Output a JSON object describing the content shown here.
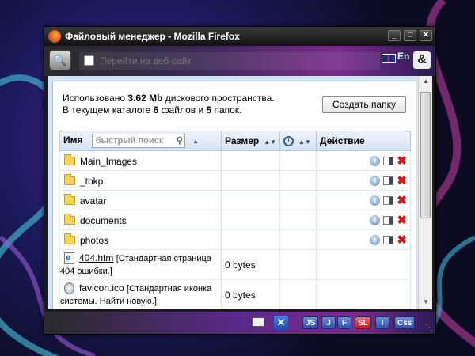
{
  "window": {
    "title": "Файловый менеджер - Mozilla Firefox",
    "controls": {
      "minimize": "_",
      "maximize": "□",
      "close": "✕"
    }
  },
  "toolbar": {
    "search_placeholder": "Перейти на веб-сайт",
    "lang": "En",
    "amp": "&"
  },
  "info": {
    "used_prefix": "Использовано ",
    "used_value": "3.62 Mb",
    "used_suffix": " дискового пространства.",
    "dir_prefix": "В текущем каталоге ",
    "files_count": "6",
    "files_mid": " файлов и ",
    "folders_count": "5",
    "folders_suffix": " папок."
  },
  "create_folder_label": "Создать папку",
  "table": {
    "headers": {
      "name": "Имя",
      "size": "Размер",
      "action": "Действие"
    },
    "search_placeholder": "быстрый поиск",
    "folders": [
      "Main_Images",
      "_tbkp",
      "avatar",
      "documents",
      "photos"
    ],
    "files": [
      {
        "name": "404.htm",
        "desc": "[Стандартная страница 404 ошибки.]",
        "size": "0 bytes"
      },
      {
        "name": "favicon.ico",
        "desc_pre": "[Стандартная иконка системы. ",
        "desc_link": "Найти новую",
        "desc_post": ".]",
        "size": "0 bytes"
      }
    ]
  },
  "statusbar": {
    "buttons": [
      "JS",
      "J",
      "F",
      "SL",
      "I",
      "Css"
    ],
    "cross_icon": "✕"
  },
  "icons": [
    "firefox-icon",
    "site-icon",
    "flag-icon",
    "folder-icon",
    "info-icon",
    "edit-icon",
    "delete-icon",
    "clock-icon",
    "search-icon",
    "mail-icon"
  ]
}
